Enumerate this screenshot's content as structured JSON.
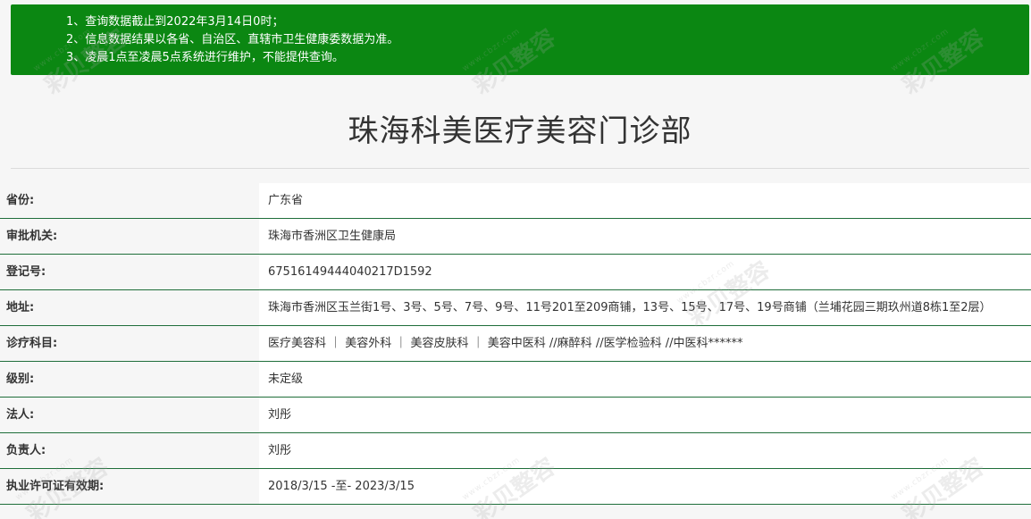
{
  "notice": {
    "lines": [
      "1、查询数据截止到2022年3月14日0时；",
      "2、信息数据结果以各省、自治区、直辖市卫生健康委数据为准。",
      "3、凌晨1点至凌晨5点系统进行维护，不能提供查询。"
    ]
  },
  "title": "珠海科美医疗美容门诊部",
  "rows": [
    {
      "label": "省份:",
      "value": "广东省"
    },
    {
      "label": "审批机关:",
      "value": "珠海市香洲区卫生健康局"
    },
    {
      "label": "登记号:",
      "value": "67516149444040217D1592"
    },
    {
      "label": "地址:",
      "value": "珠海市香洲区玉兰街1号、3号、5号、7号、9号、11号201至209商铺，13号、15号、17号、19号商铺（兰埔花园三期玖州道8栋1至2层）"
    },
    {
      "label": "诊疗科目:",
      "value": "医疗美容科 ｜ 美容外科 ｜ 美容皮肤科 ｜ 美容中医科 //麻醉科 //医学检验科 //中医科******"
    },
    {
      "label": "级别:",
      "value": "未定级"
    },
    {
      "label": "法人:",
      "value": "刘彤"
    },
    {
      "label": "负责人:",
      "value": "刘彤"
    },
    {
      "label": "执业许可证有效期:",
      "value": "2018/3/15 -至- 2023/3/15"
    }
  ],
  "watermark": {
    "text": "彩贝整容",
    "url_text": "www.cbzr.com"
  },
  "colors": {
    "notice_bg": "#0b8712",
    "row_border": "#1f6e3a",
    "page_bg": "#f6f6f6"
  }
}
